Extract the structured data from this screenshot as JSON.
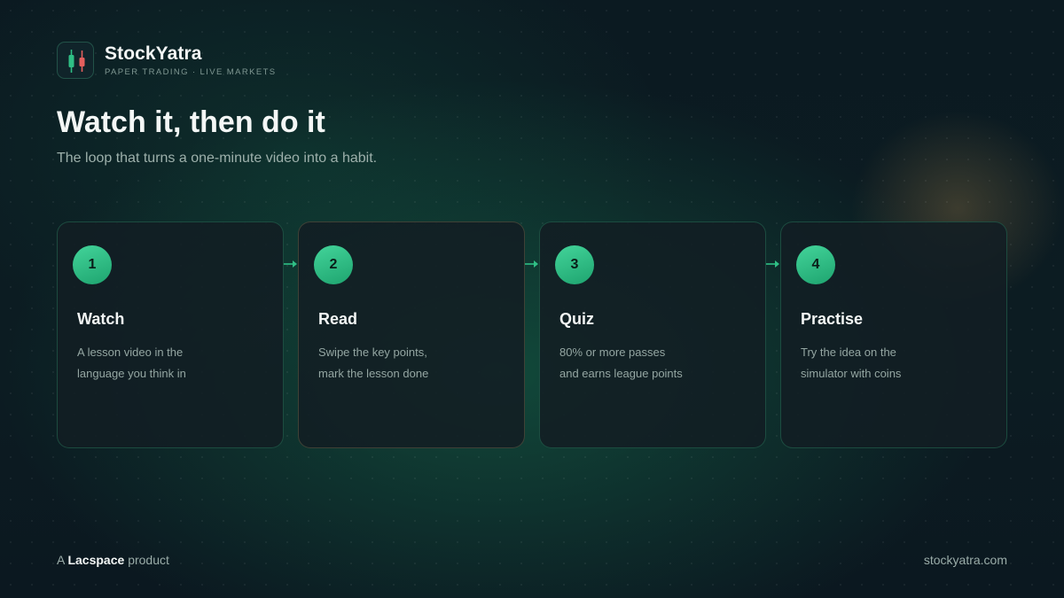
{
  "brand": {
    "name": "StockYatra",
    "tagline": "PAPER TRADING · LIVE MARKETS",
    "logo_icon": "candlestick-icon"
  },
  "hero": {
    "title": "Watch it, then do it",
    "subtitle": "The loop that turns a one-minute video into a habit."
  },
  "steps": [
    {
      "number": "1",
      "title": "Watch",
      "line1": "A lesson video in the",
      "line2": "language you think in"
    },
    {
      "number": "2",
      "title": "Read",
      "line1": "Swipe the key points,",
      "line2": "mark the lesson done"
    },
    {
      "number": "3",
      "title": "Quiz",
      "line1": "80% or more passes",
      "line2": "and earns league points"
    },
    {
      "number": "4",
      "title": "Practise",
      "line1": "Try the idea on the",
      "line2": "simulator with coins"
    }
  ],
  "footer": {
    "prefix": "A",
    "company": "Lacspace",
    "suffix": "product",
    "url": "stockyatra.com"
  },
  "colors": {
    "accent": "#2fbf85",
    "bearish": "#e4605e",
    "background": "#0b1820"
  }
}
